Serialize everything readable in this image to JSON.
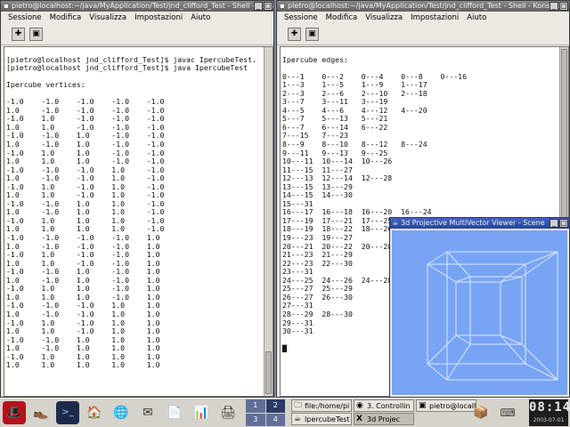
{
  "left_window": {
    "title": "pietro@localhost:~/java/MyApplication/Test/jnd_clifford_Test - Shell - Konsole",
    "menu": [
      "Sessione",
      "Modifica",
      "Visualizza",
      "Impostazioni",
      "Aiuto"
    ],
    "lines": [
      "",
      "[pietro@localhost jnd_clifford_Test]$ javac IpercubeTest.",
      "[pietro@localhost jnd_clifford_Test]$ java IpercubeTest",
      "",
      "Ipercube vertices:",
      "",
      "-1.0    -1.0    -1.0    -1.0    -1.0",
      "1.0     -1.0    -1.0    -1.0    -1.0",
      "-1.0    1.0     -1.0    -1.0    -1.0",
      "1.0     1.0     -1.0    -1.0    -1.0",
      "-1.0    -1.0    1.0     -1.0    -1.0",
      "1.0     -1.0    1.0     -1.0    -1.0",
      "-1.0    1.0     1.0     -1.0    -1.0",
      "1.0     1.0     1.0     -1.0    -1.0",
      "-1.0    -1.0    -1.0    1.0     -1.0",
      "1.0     -1.0    -1.0    1.0     -1.0",
      "-1.0    1.0     -1.0    1.0     -1.0",
      "1.0     1.0     -1.0    1.0     -1.0",
      "-1.0    -1.0    1.0     1.0     -1.0",
      "1.0     -1.0    1.0     1.0     -1.0",
      "-1.0    1.0     1.0     1.0     -1.0",
      "1.0     1.0     1.0     1.0     -1.0",
      "-1.0    -1.0    -1.0    -1.0    1.0",
      "1.0     -1.0    -1.0    -1.0    1.0",
      "-1.0    1.0     -1.0    -1.0    1.0",
      "1.0     1.0     -1.0    -1.0    1.0",
      "-1.0    -1.0    1.0     -1.0    1.0",
      "1.0     -1.0    1.0     -1.0    1.0",
      "-1.0    1.0     1.0     -1.0    1.0",
      "1.0     1.0     1.0     -1.0    1.0",
      "-1.0    -1.0    -1.0    1.0     1.0",
      "1.0     -1.0    -1.0    1.0     1.0",
      "-1.0    1.0     -1.0    1.0     1.0",
      "1.0     1.0     -1.0    1.0     1.0",
      "-1.0    -1.0    1.0     1.0     1.0",
      "1.0     -1.0    1.0     1.0     1.0",
      "-1.0    1.0     1.0     1.0     1.0",
      "1.0     1.0     1.0     1.0     1.0"
    ]
  },
  "right_window": {
    "title": "pietro@localhost:~/java/MyApplication/Test/jnd_clifford_Test - Shell - Konsole",
    "menu": [
      "Sessione",
      "Modifica",
      "Visualizza",
      "Impostazioni",
      "Aiuto"
    ],
    "lines": [
      "",
      "Ipercube edges:",
      "",
      "0---1    0---2    0---4    0---8    0---16",
      "1---3    1---5    1---9    1---17",
      "2---3    2---6    2---10   2---18",
      "3---7    3---11   3---19",
      "4---5    4---6    4---12   4---20",
      "5---7    5---13   5---21",
      "6---7    6---14   6---22",
      "7---15   7---23",
      "8---9    8---10   8---12   8---24",
      "9---11   9---13   9---25",
      "10---11  10---14  10---26",
      "11---15  11---27",
      "12---13  12---14  12---28",
      "13---15  13---29",
      "14---15  14---30",
      "15---31",
      "16---17  16---18  16---20  16---24",
      "17---19  17---21  17---25",
      "18---19  18---22  18---26",
      "19---23  19---27",
      "20---21  20---22  20---28",
      "21---23  21---29",
      "22---23  22---30",
      "23---31",
      "24---25  24---26  24---28",
      "25---27  25---29",
      "26---27  26---30",
      "27---31",
      "28---29  28---30",
      "29---31",
      "30---31",
      "",
      "▇"
    ]
  },
  "viewer": {
    "title": "3d Projective MultiVector Viewer - Scene",
    "bg_color": "#78a4f4",
    "line_color": "#dce8ff"
  },
  "taskbar": {
    "launchers": [
      "redhat-icon",
      "shoes-icon",
      "terminal-icon",
      "home-folder-icon",
      "globe-icon",
      "mail-icon",
      "document-icon",
      "chart-icon"
    ],
    "pager": [
      "1",
      "2",
      "3",
      "4"
    ],
    "tasks": [
      {
        "label": "file:/home/pi",
        "icon": "folder-icon"
      },
      {
        "label": "3. Controllin",
        "icon": "browser-icon"
      },
      {
        "label": "pietro@localh",
        "icon": "terminal-icon"
      },
      {
        "label": "IpercubeTest",
        "icon": "java-icon"
      },
      {
        "label": "3d Projec",
        "icon": "x-icon"
      }
    ],
    "clock_time": "08:14",
    "clock_date": "2003-07-01"
  }
}
